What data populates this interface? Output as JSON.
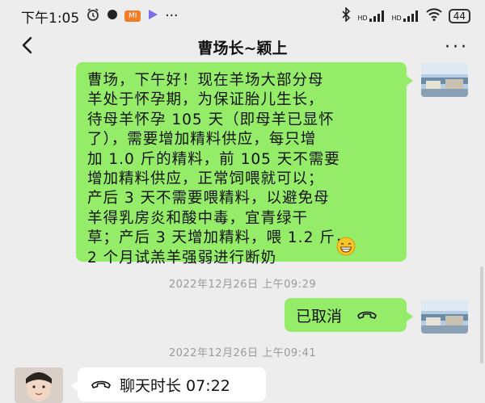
{
  "status_bar": {
    "time": "下午1:05",
    "badge_app": "MI",
    "more": "···",
    "network_1": "HD",
    "network_2": "HD",
    "battery": "44"
  },
  "header": {
    "back_icon": "chevron-left-icon",
    "title": "曹场长~颖上",
    "more_icon": "···"
  },
  "messages": [
    {
      "type": "text",
      "side": "right",
      "text": "曹场，下午好！现在羊场大部分母\n羊处于怀孕期，为保证胎儿生长，\n待母羊怀孕 105 天（即母羊已显怀\n了），需要增加精料供应，每只增\n加 1.0 斤的精料，前 105 天不需要\n增加精料供应，正常饲喂就可以；\n产后 3 天不需要喂精料，以避免母\n羊得乳房炎和酸中毒，宜青绿干\n草；产后 3 天增加精料，喂 1.2 斤，\n2 个月试羔羊强弱进行断奶",
      "emoji": "grinning-face-emoji"
    },
    {
      "type": "timestamp",
      "text": "2022年12月26日 上午09:29"
    },
    {
      "type": "call",
      "side": "right",
      "text": "已取消",
      "icon": "phone-hangup-icon"
    },
    {
      "type": "timestamp",
      "text": "2022年12月26日 上午09:41"
    },
    {
      "type": "call",
      "side": "left",
      "text": "聊天时长 07:22",
      "icon": "phone-hangup-icon"
    }
  ],
  "colors": {
    "background": "#ededed",
    "sent_bubble": "#95ec69",
    "received_bubble": "#ffffff",
    "timestamp": "#9a9a9a"
  }
}
